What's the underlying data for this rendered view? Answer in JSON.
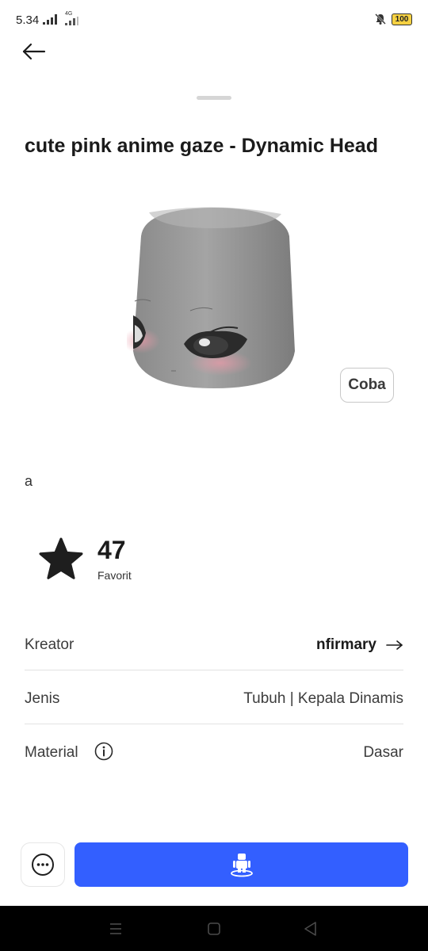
{
  "status_bar": {
    "time": "5.34",
    "network_type": "4G",
    "battery": "100",
    "icons": [
      "signal-icon",
      "signal-4g-icon",
      "mute-icon",
      "battery-icon"
    ]
  },
  "header": {
    "back_icon": "arrow-left-icon"
  },
  "item": {
    "title": "cute pink anime gaze - Dynamic Head",
    "image": "dynamic-head-preview",
    "try_label": "Coba",
    "description": "a"
  },
  "favorites": {
    "icon": "star-icon",
    "count": "47",
    "label": "Favorit"
  },
  "details": {
    "creator": {
      "label": "Kreator",
      "value": "nfirmary",
      "icon": "arrow-right-icon"
    },
    "type": {
      "label": "Jenis",
      "value": "Tubuh | Kepala Dinamis"
    },
    "material": {
      "label": "Material",
      "value": "Dasar",
      "icon": "info-icon"
    }
  },
  "actions": {
    "more_icon": "more-horizontal-icon",
    "try_on_icon": "avatar-try-on-icon",
    "primary_color": "#335fff"
  },
  "system_nav": {
    "icons": [
      "menu-icon",
      "home-icon",
      "back-triangle-icon"
    ]
  }
}
